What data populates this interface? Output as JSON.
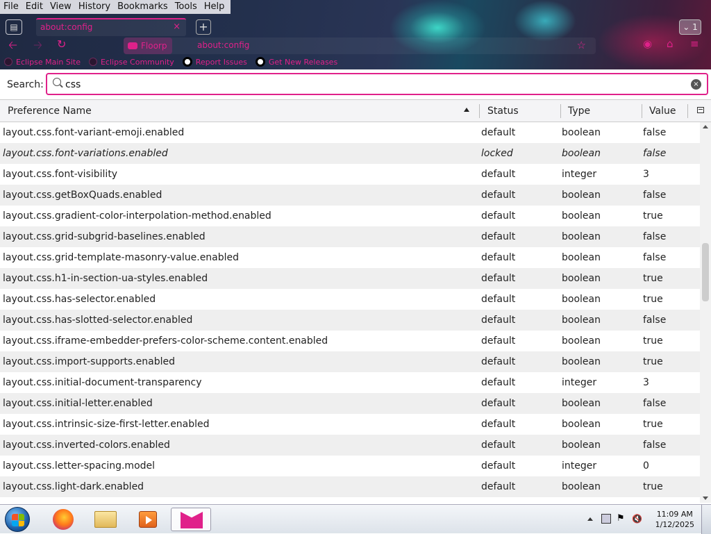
{
  "menu": [
    "File",
    "Edit",
    "View",
    "History",
    "Bookmarks",
    "Tools",
    "Help"
  ],
  "tab": {
    "title": "about:config",
    "close": "×",
    "count": "1"
  },
  "urlbar": {
    "identity_label": "Floorp",
    "url": "about:config"
  },
  "bookmarks": [
    {
      "label": "Eclipse Main Site",
      "icon": "eclipse-icon"
    },
    {
      "label": "Eclipse Community",
      "icon": "eclipse-icon"
    },
    {
      "label": "Report Issues",
      "icon": "github-icon"
    },
    {
      "label": "Get New Releases",
      "icon": "github-icon"
    }
  ],
  "search": {
    "label": "Search:",
    "value": "css"
  },
  "columns": {
    "name": "Preference Name",
    "status": "Status",
    "type": "Type",
    "value": "Value"
  },
  "rows": [
    {
      "name": "layout.css.font-variant-emoji.enabled",
      "status": "default",
      "type": "boolean",
      "value": "false"
    },
    {
      "name": "layout.css.font-variations.enabled",
      "status": "locked",
      "type": "boolean",
      "value": "false"
    },
    {
      "name": "layout.css.font-visibility",
      "status": "default",
      "type": "integer",
      "value": "3"
    },
    {
      "name": "layout.css.getBoxQuads.enabled",
      "status": "default",
      "type": "boolean",
      "value": "false"
    },
    {
      "name": "layout.css.gradient-color-interpolation-method.enabled",
      "status": "default",
      "type": "boolean",
      "value": "true"
    },
    {
      "name": "layout.css.grid-subgrid-baselines.enabled",
      "status": "default",
      "type": "boolean",
      "value": "false"
    },
    {
      "name": "layout.css.grid-template-masonry-value.enabled",
      "status": "default",
      "type": "boolean",
      "value": "false"
    },
    {
      "name": "layout.css.h1-in-section-ua-styles.enabled",
      "status": "default",
      "type": "boolean",
      "value": "true"
    },
    {
      "name": "layout.css.has-selector.enabled",
      "status": "default",
      "type": "boolean",
      "value": "true"
    },
    {
      "name": "layout.css.has-slotted-selector.enabled",
      "status": "default",
      "type": "boolean",
      "value": "false"
    },
    {
      "name": "layout.css.iframe-embedder-prefers-color-scheme.content.enabled",
      "status": "default",
      "type": "boolean",
      "value": "true"
    },
    {
      "name": "layout.css.import-supports.enabled",
      "status": "default",
      "type": "boolean",
      "value": "true"
    },
    {
      "name": "layout.css.initial-document-transparency",
      "status": "default",
      "type": "integer",
      "value": "3"
    },
    {
      "name": "layout.css.initial-letter.enabled",
      "status": "default",
      "type": "boolean",
      "value": "false"
    },
    {
      "name": "layout.css.intrinsic-size-first-letter.enabled",
      "status": "default",
      "type": "boolean",
      "value": "true"
    },
    {
      "name": "layout.css.inverted-colors.enabled",
      "status": "default",
      "type": "boolean",
      "value": "false"
    },
    {
      "name": "layout.css.letter-spacing.model",
      "status": "default",
      "type": "integer",
      "value": "0"
    },
    {
      "name": "layout.css.light-dark.enabled",
      "status": "default",
      "type": "boolean",
      "value": "true"
    }
  ],
  "taskbar": {
    "time": "11:09 AM",
    "date": "1/12/2025"
  },
  "colors": {
    "accent": "#e0218a"
  }
}
